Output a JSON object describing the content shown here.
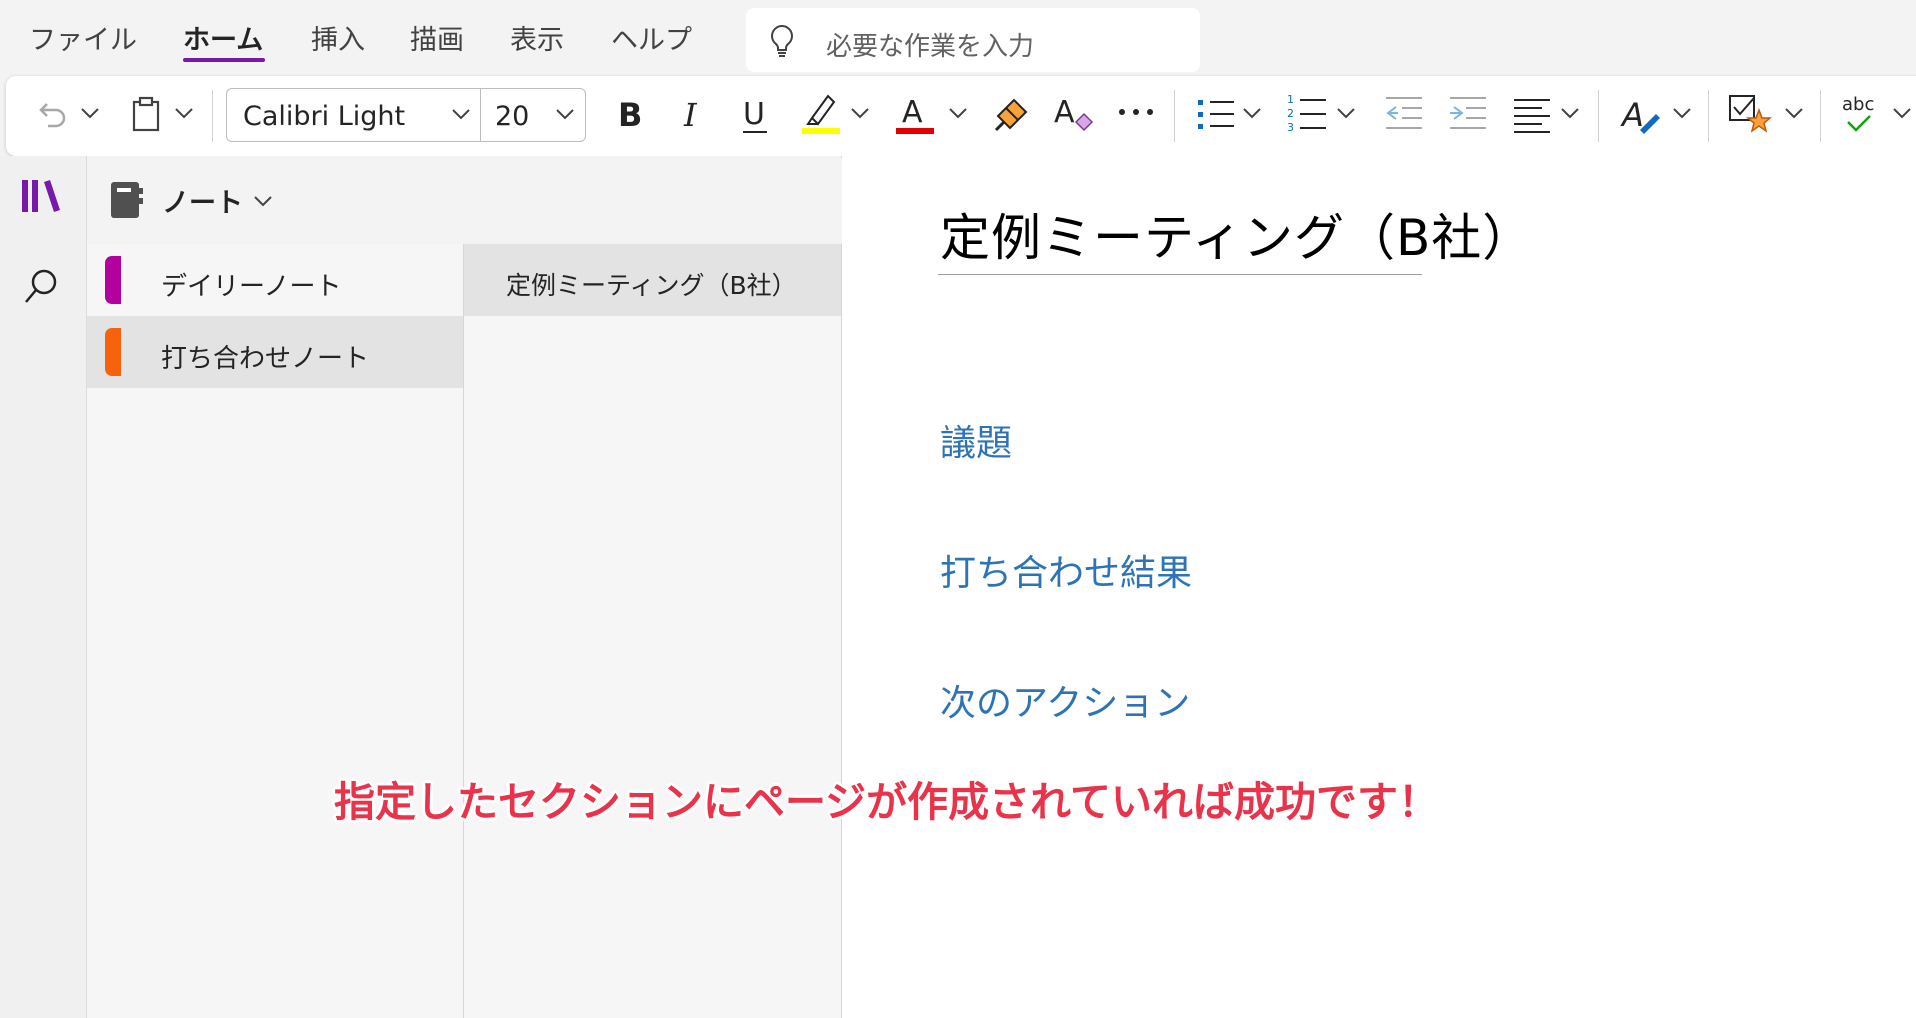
{
  "menu": {
    "items": [
      {
        "label": "ファイル"
      },
      {
        "label": "ホーム"
      },
      {
        "label": "挿入"
      },
      {
        "label": "描画"
      },
      {
        "label": "表示"
      },
      {
        "label": "ヘルプ"
      }
    ],
    "active_index": 1
  },
  "search": {
    "placeholder": "必要な作業を入力"
  },
  "ribbon": {
    "font_name": "Calibri Light",
    "font_size": "20",
    "highlight_color": "#ffff00",
    "font_color": "#e00000",
    "spelling_icon_label": "abc",
    "numbering_digits": [
      "1",
      "2",
      "3"
    ]
  },
  "notebook": {
    "title": "ノート"
  },
  "sections": [
    {
      "label": "デイリーノート",
      "color": "#b4009e"
    },
    {
      "label": "打ち合わせノート",
      "color": "#f7630c"
    }
  ],
  "pages": [
    {
      "label": "定例ミーティング（B社）"
    }
  ],
  "page": {
    "title": "定例ミーティング（B社）",
    "headings": [
      "議題",
      "打ち合わせ結果",
      "次のアクション"
    ]
  },
  "annotation": {
    "text": "指定したセクションにページが作成されていれば成功です！"
  }
}
